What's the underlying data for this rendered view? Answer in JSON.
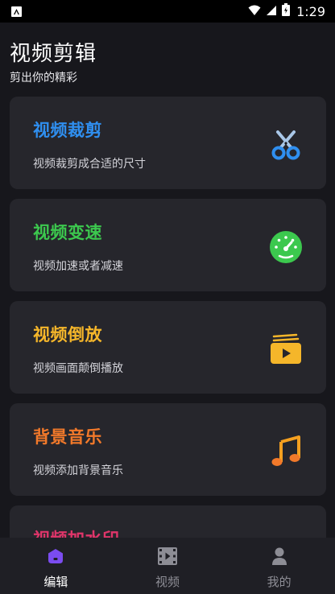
{
  "status_bar": {
    "time": "1:29"
  },
  "header": {
    "title": "视频剪辑",
    "subtitle": "剪出你的精彩"
  },
  "cards": [
    {
      "title": "视频裁剪",
      "desc": "视频裁剪成合适的尺寸",
      "color": "#2f8ff0",
      "icon": "scissors-icon"
    },
    {
      "title": "视频变速",
      "desc": "视频加速或者减速",
      "color": "#3cc84e",
      "icon": "speedometer-icon"
    },
    {
      "title": "视频倒放",
      "desc": "视频画面颠倒播放",
      "color": "#f5b62a",
      "icon": "reverse-play-icon"
    },
    {
      "title": "背景音乐",
      "desc": "视频添加背景音乐",
      "color": "#f2792a",
      "icon": "music-note-icon"
    },
    {
      "title": "视频加水印",
      "desc": "",
      "color": "#e0356a",
      "icon": "watermark-icon"
    }
  ],
  "bottom_nav": [
    {
      "label": "编辑",
      "icon": "edit-home-icon",
      "active": true,
      "color": "#7b4cf0"
    },
    {
      "label": "视频",
      "icon": "film-icon",
      "active": false
    },
    {
      "label": "我的",
      "icon": "profile-icon",
      "active": false
    }
  ]
}
